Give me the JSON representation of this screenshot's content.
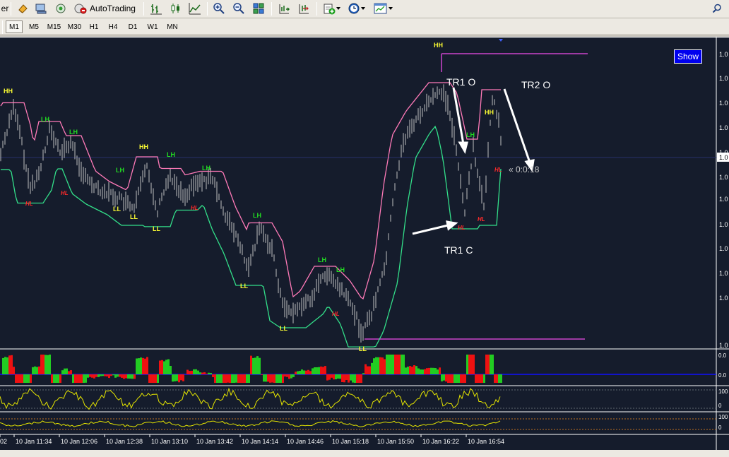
{
  "toolbar": {
    "partial_label": "er",
    "autotrading_label": "AutoTrading"
  },
  "timeframes": [
    "M1",
    "M5",
    "M15",
    "M30",
    "H1",
    "H4",
    "D1",
    "W1",
    "MN"
  ],
  "active_timeframe": "M1",
  "chart": {
    "show_button": "Show",
    "countdown": "« 0:0:18",
    "annotations": {
      "tr1o": "TR1 O",
      "tr2o": "TR2 O",
      "tr1c": "TR1 C"
    },
    "price_labels": [
      "1.0",
      "1.0",
      "1.0",
      "1.0",
      "1.0",
      "1.0",
      "1.0",
      "1.0",
      "1.0",
      "1.0",
      "1.0",
      "1.0"
    ],
    "current_price_label": "1.0",
    "ind1_labels": [
      "0.0",
      "0.0"
    ],
    "ind2_labels": [
      "100",
      "0"
    ],
    "ind3_labels": [
      "100",
      "0"
    ],
    "time_labels": [
      "02",
      "10 Jan 11:34",
      "10 Jan 12:06",
      "10 Jan 12:38",
      "10 Jan 13:10",
      "10 Jan 13:42",
      "10 Jan 14:14",
      "10 Jan 14:46",
      "10 Jan 15:18",
      "10 Jan 15:50",
      "10 Jan 16:22",
      "10 Jan 16:54"
    ],
    "swing_labels": [
      {
        "t": "HH",
        "c": "yellow"
      },
      {
        "t": "LH",
        "c": "green"
      },
      {
        "t": "LH",
        "c": "green"
      },
      {
        "t": "HL",
        "c": "red"
      },
      {
        "t": "HL",
        "c": "red"
      },
      {
        "t": "HH",
        "c": "yellow"
      },
      {
        "t": "LH",
        "c": "green"
      },
      {
        "t": "LH",
        "c": "green"
      },
      {
        "t": "LH",
        "c": "green"
      },
      {
        "t": "LL",
        "c": "yellow"
      },
      {
        "t": "LL",
        "c": "yellow"
      },
      {
        "t": "LL",
        "c": "yellow"
      },
      {
        "t": "HL",
        "c": "red"
      },
      {
        "t": "LH",
        "c": "green"
      },
      {
        "t": "LL",
        "c": "yellow"
      },
      {
        "t": "LH",
        "c": "green"
      },
      {
        "t": "LH",
        "c": "green"
      },
      {
        "t": "HL",
        "c": "red"
      },
      {
        "t": "LL",
        "c": "yellow"
      },
      {
        "t": "LL",
        "c": "yellow"
      },
      {
        "t": "HH",
        "c": "yellow"
      },
      {
        "t": "LH",
        "c": "green"
      },
      {
        "t": "HH",
        "c": "yellow"
      },
      {
        "t": "HL",
        "c": "red"
      },
      {
        "t": "HL",
        "c": "red"
      },
      {
        "t": "HL",
        "c": "red"
      }
    ]
  },
  "colors": {
    "background": "#151c2c",
    "candle": "#bfbfbf",
    "upper_band": "#ff7ab8",
    "lower_band": "#33e08a",
    "hh_ll": "#ffff33",
    "lh": "#22dd22",
    "hl": "#ff2a2a",
    "level_line": "#cc44cc",
    "osc": "#e6e600"
  }
}
